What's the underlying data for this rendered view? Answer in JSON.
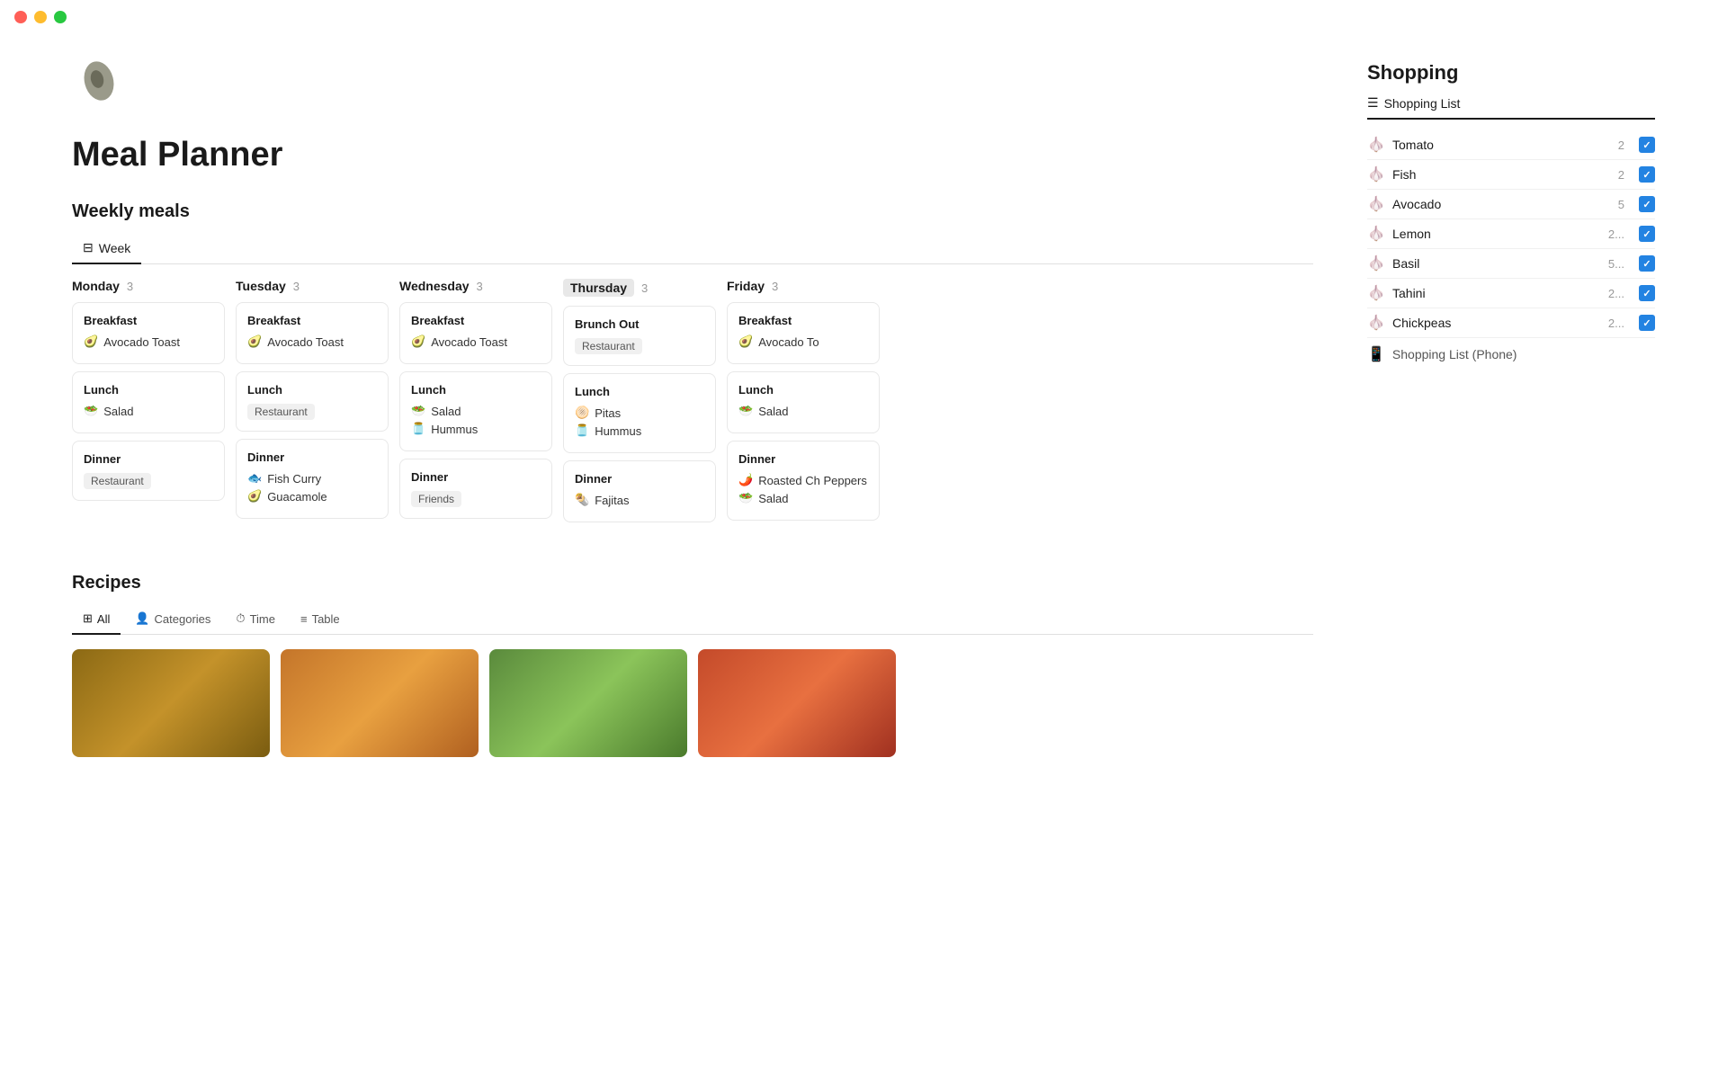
{
  "titlebar": {
    "close": "close",
    "minimize": "minimize",
    "maximize": "maximize"
  },
  "page": {
    "title": "Meal Planner"
  },
  "weekly_meals": {
    "section_title": "Weekly meals",
    "tab_label": "Week",
    "days": [
      {
        "name": "Monday",
        "highlighted": false,
        "count": "3",
        "meals": [
          {
            "type": "Breakfast",
            "items": [
              {
                "icon": "🥑",
                "text": "Avocado Toast"
              }
            ],
            "tag": null
          },
          {
            "type": "Lunch",
            "items": [
              {
                "icon": "🥗",
                "text": "Salad"
              }
            ],
            "tag": null
          },
          {
            "type": "Dinner",
            "items": [],
            "tag": "Restaurant"
          }
        ]
      },
      {
        "name": "Tuesday",
        "highlighted": false,
        "count": "3",
        "meals": [
          {
            "type": "Breakfast",
            "items": [
              {
                "icon": "🥑",
                "text": "Avocado Toast"
              }
            ],
            "tag": null
          },
          {
            "type": "Lunch",
            "items": [],
            "tag": "Restaurant"
          },
          {
            "type": "Dinner",
            "items": [
              {
                "icon": "🐟",
                "text": "Fish Curry"
              },
              {
                "icon": "🥑",
                "text": "Guacamole"
              }
            ],
            "tag": null
          }
        ]
      },
      {
        "name": "Wednesday",
        "highlighted": false,
        "count": "3",
        "meals": [
          {
            "type": "Breakfast",
            "items": [
              {
                "icon": "🥑",
                "text": "Avocado Toast"
              }
            ],
            "tag": null
          },
          {
            "type": "Lunch",
            "items": [
              {
                "icon": "🥗",
                "text": "Salad"
              },
              {
                "icon": "🫙",
                "text": "Hummus"
              }
            ],
            "tag": null
          },
          {
            "type": "Dinner",
            "items": [],
            "tag": "Friends"
          }
        ]
      },
      {
        "name": "Thursday",
        "highlighted": true,
        "count": "3",
        "meals": [
          {
            "type": "Brunch Out",
            "items": [],
            "tag": "Restaurant"
          },
          {
            "type": "Lunch",
            "items": [
              {
                "icon": "🫓",
                "text": "Pitas"
              },
              {
                "icon": "🫙",
                "text": "Hummus"
              }
            ],
            "tag": null
          },
          {
            "type": "Dinner",
            "items": [
              {
                "icon": "🌯",
                "text": "Fajitas"
              }
            ],
            "tag": null
          }
        ]
      },
      {
        "name": "Friday",
        "highlighted": false,
        "count": "3",
        "meals": [
          {
            "type": "Breakfast",
            "items": [
              {
                "icon": "🥑",
                "text": "Avocado To"
              }
            ],
            "tag": null
          },
          {
            "type": "Lunch",
            "items": [
              {
                "icon": "🥗",
                "text": "Salad"
              }
            ],
            "tag": null
          },
          {
            "type": "Dinner",
            "items": [
              {
                "icon": "🌶️",
                "text": "Roasted Ch Peppers"
              },
              {
                "icon": "🥗",
                "text": "Salad"
              }
            ],
            "tag": null
          }
        ]
      }
    ]
  },
  "shopping": {
    "section_title": "Shopping",
    "list_label": "Shopping List",
    "items": [
      {
        "icon": "🧄",
        "name": "Tomato",
        "qty": "2",
        "checked": true
      },
      {
        "icon": "🧄",
        "name": "Fish",
        "qty": "2",
        "checked": true
      },
      {
        "icon": "🧄",
        "name": "Avocado",
        "qty": "5",
        "checked": true
      },
      {
        "icon": "🧄",
        "name": "Lemon",
        "qty": "2...",
        "checked": true
      },
      {
        "icon": "🧄",
        "name": "Basil",
        "qty": "5...",
        "checked": true
      },
      {
        "icon": "🧄",
        "name": "Tahini",
        "qty": "2...",
        "checked": true
      },
      {
        "icon": "🧄",
        "name": "Chickpeas",
        "qty": "2...",
        "checked": true
      }
    ],
    "phone_list_label": "Shopping List (Phone)"
  },
  "recipes": {
    "section_title": "Recipes",
    "tabs": [
      {
        "label": "All",
        "icon": "⊞",
        "active": true
      },
      {
        "label": "Categories",
        "icon": "👤",
        "active": false
      },
      {
        "label": "Time",
        "icon": "⏱",
        "active": false
      },
      {
        "label": "Table",
        "icon": "≡",
        "active": false
      }
    ]
  }
}
